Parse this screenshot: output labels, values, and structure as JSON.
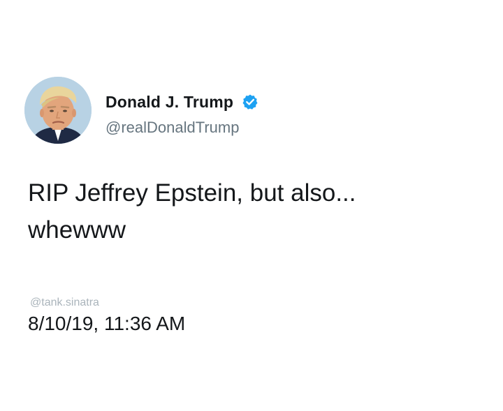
{
  "author": {
    "name": "Donald J. Trump",
    "handle": "@realDonaldTrump",
    "verified": true,
    "avatar_icon": "profile-photo"
  },
  "tweet": {
    "lines": [
      "RIP Jeffrey Epstein, but also...",
      "whewww"
    ]
  },
  "watermark": "@tank.sinatra",
  "timestamp": "8/10/19, 11:36 AM",
  "colors": {
    "text": "#14171a",
    "handle": "#66757f",
    "watermark": "#aab4bb",
    "verified": "#1da1f2",
    "avatar_bg": "#b8d2e4"
  }
}
